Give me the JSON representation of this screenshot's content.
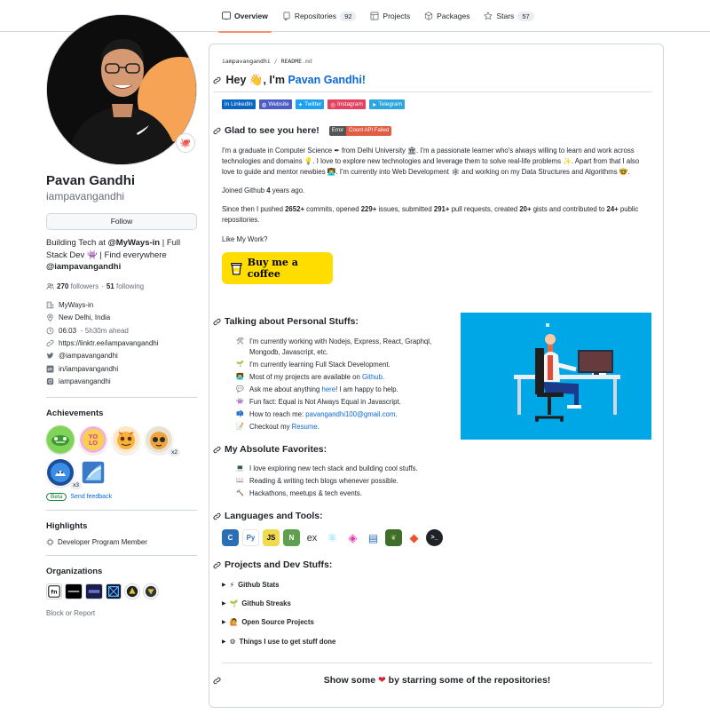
{
  "nav": {
    "tabs": [
      {
        "label": "Overview",
        "count": ""
      },
      {
        "label": "Repositories",
        "count": "92"
      },
      {
        "label": "Projects",
        "count": ""
      },
      {
        "label": "Packages",
        "count": ""
      },
      {
        "label": "Stars",
        "count": "57"
      }
    ]
  },
  "profile": {
    "name": "Pavan Gandhi",
    "login": "iampavangandhi",
    "follow_label": "Follow",
    "bio_prefix": "Building Tech at ",
    "bio_org": "@MyWays-in",
    "bio_mid": " | Full Stack Dev ",
    "bio_emoji": "👾",
    "bio_mid2": " | Find everywhere ",
    "bio_handle": "@iampavangandhi",
    "followers": "270",
    "followers_label": "followers",
    "dot": "·",
    "following": "51",
    "following_label": "following",
    "company": "MyWays-in",
    "location": "New Delhi, India",
    "time": "06:03",
    "time_note": "- 5h30m ahead",
    "website": "https://linktr.ee/iampavangandhi",
    "twitter": "@iampavangandhi",
    "linkedin": "in/iampavangandhi",
    "instagram": "iampavangandhi",
    "status_emoji": "🐙"
  },
  "achievements": {
    "title": "Achievements",
    "items": [
      {
        "name": "pull-shark",
        "mult": ""
      },
      {
        "name": "yolo",
        "mult": ""
      },
      {
        "name": "starstruck",
        "mult": ""
      },
      {
        "name": "pair-extraordinaire",
        "mult": "x2"
      },
      {
        "name": "arctic-code-vault",
        "mult": "x3"
      },
      {
        "name": "quickdraw",
        "mult": ""
      }
    ],
    "beta_label": "Beta",
    "feedback_label": "Send feedback"
  },
  "highlights": {
    "title": "Highlights",
    "item": "Developer Program Member"
  },
  "organizations": {
    "title": "Organizations",
    "block_label": "Block or Report"
  },
  "readme": {
    "crumb_user": "iampavangandhi",
    "crumb_slash": "/",
    "crumb_file": "README",
    "crumb_ext": ".md",
    "greeting": "Hey 👋, I'm ",
    "greeting_name": "Pavan Gandhi!",
    "badges": [
      {
        "label": "LinkedIn",
        "color": "#0a66c2"
      },
      {
        "label": "Website",
        "color": "#4d5dc5"
      },
      {
        "label": "Twitter",
        "color": "#1da1f2"
      },
      {
        "label": "Instagram",
        "color": "#e4405f"
      },
      {
        "label": "Telegram",
        "color": "#2ca5e0"
      }
    ],
    "glad_heading": "Glad to see you here!",
    "err_left": "Error",
    "err_right": "Count API Failed",
    "intro_1": "I'm a graduate in Computer Science ✒ from Delhi University 🏛. I'm a passionate learner who's always willing to learn and work across technologies and domains 💡. I love to explore new technologies and leverage them to solve real-life problems ✨. Apart from that I also love to guide and mentor newbies 👨‍💻. I'm currently into Web Development 🕸 and working on my Data Structures and Algorithms 🤓.",
    "joined_prefix": "Joined Github ",
    "joined_years": "4",
    "joined_suffix": " years ago.",
    "since_1": "Since then I pushed ",
    "commits": "2652+",
    "since_2": " commits, opened ",
    "issues": "229+",
    "since_3": " issues, submitted ",
    "prs": "291+",
    "since_4": " pull requests, created ",
    "gists": "20+",
    "since_5": " gists and contributed to ",
    "repos": "24+",
    "since_6": " public repositories.",
    "like_my_work": "Like My Work?",
    "coffee_label": "Buy me a coffee",
    "talking_heading": "Talking about Personal Stuffs:",
    "talking": [
      {
        "em": "🛠",
        "text": "I'm currently working with Nodejs, Express, React, Graphql, Mongodb, Javascript, etc.",
        "link": "",
        "tail": ""
      },
      {
        "em": "🌱",
        "text": "I'm currently learning Full Stack Development.",
        "link": "",
        "tail": ""
      },
      {
        "em": "👨‍💻",
        "text": "Most of my projects are available on ",
        "link": "Github",
        "tail": "."
      },
      {
        "em": "💬",
        "text": "Ask me about anything ",
        "link": "here",
        "tail": "! I am happy to help."
      },
      {
        "em": "👾",
        "text": "Fun fact: Equal is Not Always Equal in Javascript.",
        "link": "",
        "tail": ""
      },
      {
        "em": "📫",
        "text": "How to reach me: ",
        "link": "pavangandhi100@gmail.com",
        "tail": "."
      },
      {
        "em": "📝",
        "text": "Checkout my ",
        "link": "Resume",
        "tail": "."
      }
    ],
    "favorites_heading": "My Absolute Favorites:",
    "favorites": [
      {
        "em": "💻",
        "text": "I love exploring new tech stack and building cool stuffs."
      },
      {
        "em": "📖",
        "text": "Reading & writing tech blogs whenever possible."
      },
      {
        "em": "🔨",
        "text": "Hackathons, meetups & tech events."
      }
    ],
    "languages_heading": "Languages and Tools:",
    "tools": [
      {
        "name": "c-icon",
        "glyph": "C",
        "color": "#2a6eb5"
      },
      {
        "name": "python-icon",
        "glyph": "Py",
        "color": "#3776ab"
      },
      {
        "name": "javascript-icon",
        "glyph": "JS",
        "color": "#f0db4f"
      },
      {
        "name": "nodejs-icon",
        "glyph": "N",
        "color": "#5fa04e"
      },
      {
        "name": "express-icon",
        "glyph": "ex",
        "color": "#ffffff"
      },
      {
        "name": "react-icon",
        "glyph": "⚛",
        "color": "#ffffff"
      },
      {
        "name": "graphql-icon",
        "glyph": "◈",
        "color": "#ffffff"
      },
      {
        "name": "database-icon",
        "glyph": "▤",
        "color": "#ffffff"
      },
      {
        "name": "mongodb-icon",
        "glyph": "❦",
        "color": "#13aa52"
      },
      {
        "name": "git-icon",
        "glyph": "◆",
        "color": "#f05032"
      },
      {
        "name": "terminal-icon",
        "glyph": ">_",
        "color": "#1f2328"
      }
    ],
    "projects_heading": "Projects and Dev Stuffs:",
    "projects": [
      {
        "em": "⚡",
        "label": "Github Stats"
      },
      {
        "em": "🌱",
        "label": "Github Streaks"
      },
      {
        "em": "🙋",
        "label": "Open Source Projects"
      },
      {
        "em": "⚙",
        "label": "Things I use to get stuff done"
      }
    ],
    "footer_1": "Show some ",
    "footer_heart": "❤",
    "footer_2": " by starring some of the repositories!"
  }
}
